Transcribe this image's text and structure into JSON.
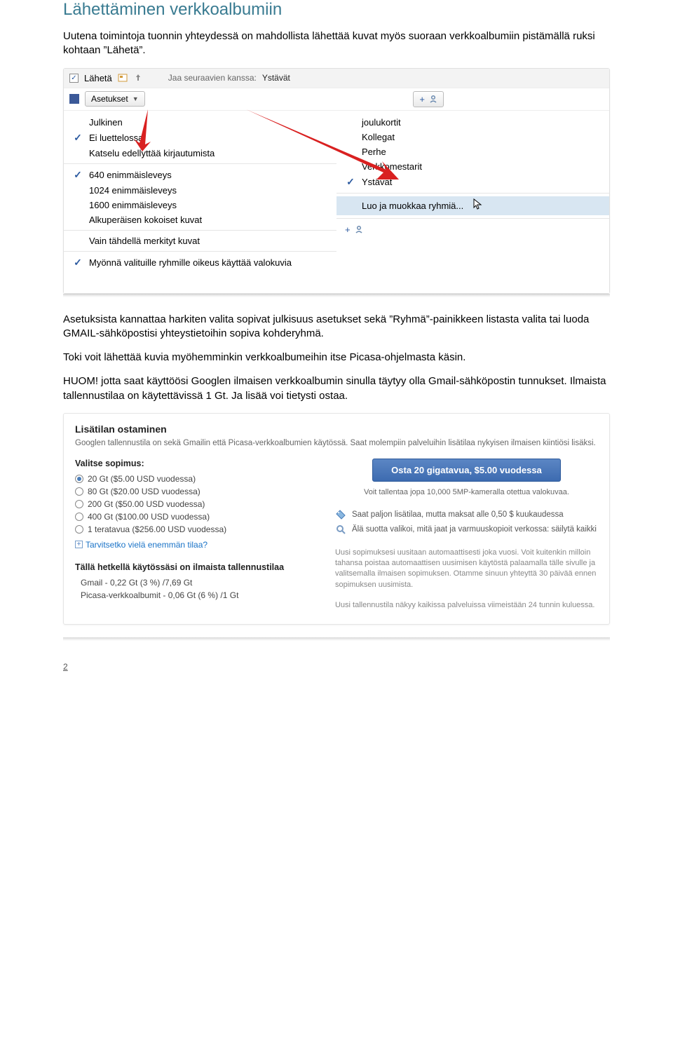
{
  "heading": "Lähettäminen verkkoalbumiin",
  "para1": "Uutena toimintoja tuonnin yhteydessä on mahdollista lähettää kuvat myös suoraan verkkoalbumiin pistämällä ruksi kohtaan ”Lähetä”.",
  "para2": "Asetuksista kannattaa harkiten valita sopivat julkisuus asetukset sekä ”Ryhmä”-painikkeen listasta valita tai luoda GMAIL-sähköpostisi yhteystietoihin sopiva kohderyhmä.",
  "para3": "Toki voit lähettää kuvia myöhemminkin verkkoalbumeihin itse Picasa-ohjelmasta käsin.",
  "para4": "HUOM! jotta saat käyttöösi Googlen ilmaisen verkkoalbumin sinulla täytyy olla Gmail-sähköpostin tunnukset. Ilmaista tallennustilaa on käytettävissä 1 Gt. Ja lisää voi tietysti ostaa.",
  "ss1": {
    "send_label": "Lähetä",
    "settings_label": "Asetukset",
    "share_prefix": "Jaa seuraavien kanssa:",
    "share_value": "Ystävät",
    "left_menu": [
      {
        "label": "Julkinen",
        "checked": false
      },
      {
        "label": "Ei luettelossa",
        "checked": true
      },
      {
        "label": "Katselu edellyttää kirjautumista",
        "checked": false
      },
      {
        "label": "640 enimmäisleveys",
        "checked": true,
        "sep_before": true
      },
      {
        "label": "1024 enimmäisleveys",
        "checked": false
      },
      {
        "label": "1600 enimmäisleveys",
        "checked": false
      },
      {
        "label": "Alkuperäisen kokoiset kuvat",
        "checked": false
      },
      {
        "label": "Vain tähdellä merkityt kuvat",
        "checked": false,
        "sep_before": true
      },
      {
        "label": "Myönnä valituille ryhmille oikeus käyttää valokuvia",
        "checked": true,
        "sep_before": true
      }
    ],
    "right_menu": [
      {
        "label": "joulukortit",
        "checked": false
      },
      {
        "label": "Kollegat",
        "checked": false
      },
      {
        "label": "Perhe",
        "checked": false
      },
      {
        "label": "Verkkomestarit",
        "checked": false
      },
      {
        "label": "Ystävät",
        "checked": true
      }
    ],
    "right_action": "Luo ja muokkaa ryhmiä..."
  },
  "shop": {
    "title": "Lisätilan ostaminen",
    "intro": "Googlen tallennustila on sekä Gmailin että Picasa-verkkoalbumien käytössä. Saat molempiin palveluihin lisätilaa nykyisen ilmaisen kiintiösi lisäksi.",
    "choose_label": "Valitse sopimus:",
    "plans": [
      {
        "label": "20 Gt ($5.00 USD vuodessa)",
        "checked": true
      },
      {
        "label": "80 Gt ($20.00 USD vuodessa)",
        "checked": false
      },
      {
        "label": "200 Gt ($50.00 USD vuodessa)",
        "checked": false
      },
      {
        "label": "400 Gt ($100.00 USD vuodessa)",
        "checked": false
      },
      {
        "label": "1 teratavua ($256.00 USD vuodessa)",
        "checked": false
      }
    ],
    "more_link": "Tarvitsetko vielä enemmän tilaa?",
    "current_h": "Tällä hetkellä käytössäsi on ilmaista tallennustilaa",
    "current1": "Gmail - 0,22 Gt (3 %) /7,69 Gt",
    "current2": "Picasa-verkkoalbumit - 0,06 Gt (6 %) /1 Gt",
    "buy_btn": "Osta 20 gigatavua, $5.00 vuodessa",
    "buy_sub": "Voit tallentaa jopa 10,000 5MP-kameralla otettua valokuvaa.",
    "benefit1": "Saat paljon lisätilaa, mutta maksat alle 0,50 $ kuukaudessa",
    "benefit2": "Älä suotta valikoi, mitä jaat ja varmuuskopioit verkossa: säilytä kaikki",
    "fine1": "Uusi sopimuksesi uusitaan automaattisesti joka vuosi. Voit kuitenkin milloin tahansa poistaa automaattisen uusimisen käytöstä palaamalla tälle sivulle ja valitsemalla ilmaisen sopimuksen. Otamme sinuun yhteyttä 30 päivää ennen sopimuksen uusimista.",
    "fine2": "Uusi tallennustila näkyy kaikissa palveluissa viimeistään 24 tunnin kuluessa."
  },
  "page_number": "2"
}
